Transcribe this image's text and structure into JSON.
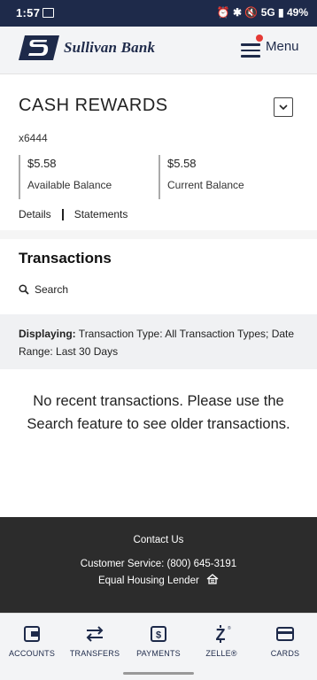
{
  "status_bar": {
    "time": "1:57",
    "right": "⏰ ✱ 🔇 5G ▮ 49%"
  },
  "header": {
    "bank_name": "Sullivan Bank",
    "menu_label": "Menu"
  },
  "account": {
    "title": "CASH REWARDS",
    "number": "x6444",
    "available_amount": "$5.58",
    "available_label": "Available Balance",
    "current_amount": "$5.58",
    "current_label": "Current Balance",
    "details_link": "Details",
    "statements_link": "Statements"
  },
  "transactions": {
    "title": "Transactions",
    "search_label": "Search",
    "displaying_label": "Displaying:",
    "displaying_text": " Transaction Type: All Transaction Types; Date Range: Last 30 Days",
    "empty_message": "No recent transactions. Please use the Search feature to see older transactions."
  },
  "footer": {
    "contact": "Contact Us",
    "customer_service": "Customer Service: (800) 645-3191",
    "equal_housing": "Equal Housing Lender"
  },
  "tabs": [
    {
      "label": "ACCOUNTS",
      "icon": "wallet-icon"
    },
    {
      "label": "TRANSFERS",
      "icon": "transfer-arrows-icon"
    },
    {
      "label": "PAYMENTS",
      "icon": "dollar-bill-icon"
    },
    {
      "label": "ZELLE®",
      "icon": "zelle-icon"
    },
    {
      "label": "CARDS",
      "icon": "credit-card-icon"
    }
  ],
  "colors": {
    "brand_navy": "#1e2a4a",
    "notification_red": "#e53935",
    "footer_bg": "#2c2c2c"
  }
}
